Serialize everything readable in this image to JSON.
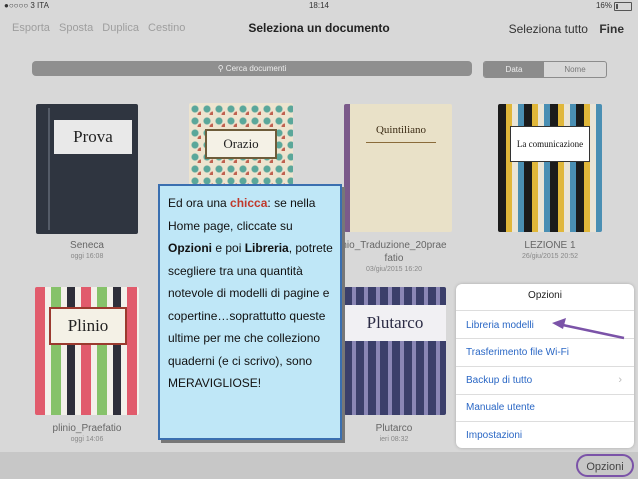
{
  "status_bar": {
    "carrier": "●○○○○ 3 ITA",
    "time": "18:14",
    "battery": "16%"
  },
  "nav": {
    "left_actions": [
      "Esporta",
      "Sposta",
      "Duplica",
      "Cestino"
    ],
    "title": "Seleziona un documento",
    "select_all": "Seleziona tutto",
    "done": "Fine"
  },
  "search": {
    "placeholder": "Cerca documenti",
    "icon": "search-icon"
  },
  "sort": {
    "options": [
      "Data",
      "Nome"
    ],
    "selected": "Data"
  },
  "documents": [
    {
      "cover_label": "Prova",
      "name": "Seneca",
      "date": "oggi 16:08"
    },
    {
      "cover_label": "Orazio",
      "name": "",
      "date": ""
    },
    {
      "cover_label": "Quintiliano",
      "name": "nio_Traduzione_20prae",
      "name2": "fatio",
      "date": "03/giu/2015 16:20"
    },
    {
      "cover_label": "La comunicazione",
      "name": "LEZIONE 1",
      "date": "26/giu/2015 20:52"
    },
    {
      "cover_label": "Plinio",
      "name": "plinio_Praefatio",
      "date": "oggi 14:06"
    },
    {
      "cover_label": "Plutarco",
      "name": "Plutarco",
      "date": "ieri 08:32"
    }
  ],
  "callout": {
    "t1": "Ed ora una ",
    "t2": "chicca",
    "t3": ": se nella Home page, cliccate su ",
    "t4": "Opzioni",
    "t5": " e poi ",
    "t6": "Libreria",
    "t7": ", potrete scegliere tra una quantità notevole di modelli di pagine e copertine…soprattutto queste ultime per me che colleziono quaderni (e ci scrivo), sono MERAVIGLIOSE!"
  },
  "options_popover": {
    "title": "Opzioni",
    "items": [
      "Libreria modelli",
      "Trasferimento file Wi-Fi",
      "Backup di tutto",
      "Manuale utente",
      "Impostazioni"
    ]
  },
  "bottom": {
    "options_button": "Opzioni"
  },
  "colors": {
    "accent": "#2a67c5",
    "callout_bg": "#bfe7f7",
    "highlight": "#7b53a8"
  }
}
